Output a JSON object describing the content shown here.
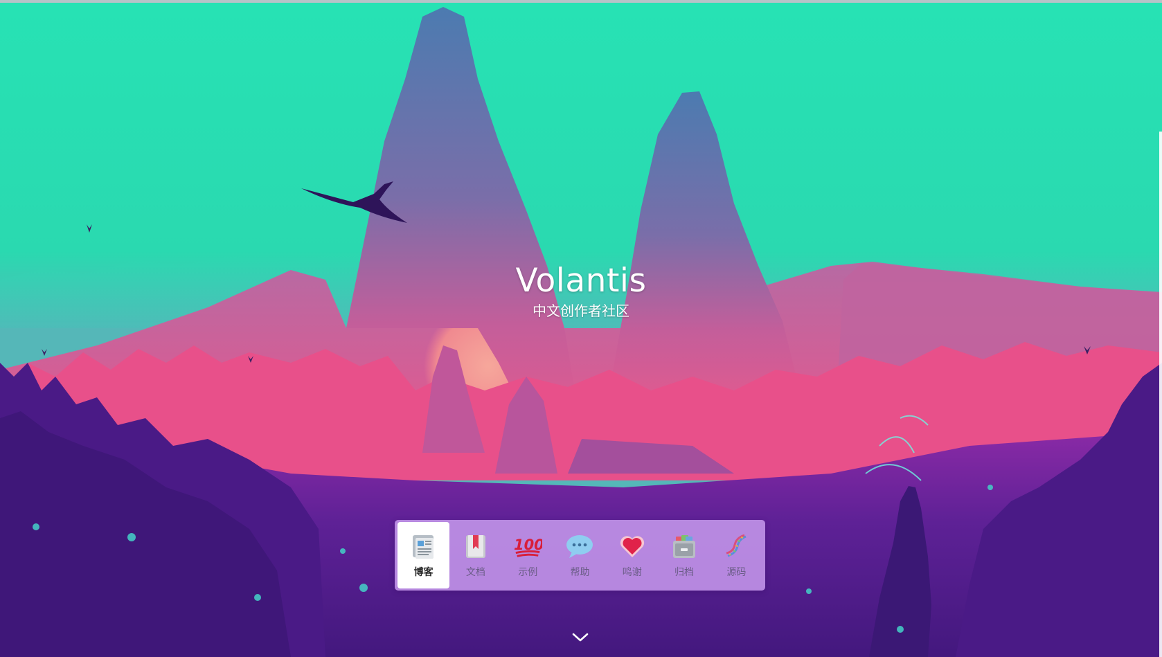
{
  "hero": {
    "title": "Volantis",
    "subtitle": "中文创作者社区"
  },
  "nav": {
    "items": [
      {
        "label": "博客",
        "icon": "newspaper-icon",
        "active": true
      },
      {
        "label": "文档",
        "icon": "bookmark-book-icon",
        "active": false
      },
      {
        "label": "示例",
        "icon": "hundred-points-icon",
        "active": false
      },
      {
        "label": "帮助",
        "icon": "speech-bubble-icon",
        "active": false
      },
      {
        "label": "鸣谢",
        "icon": "heart-icon",
        "active": false
      },
      {
        "label": "归档",
        "icon": "file-cabinet-icon",
        "active": false
      },
      {
        "label": "源码",
        "icon": "dna-icon",
        "active": false
      }
    ]
  },
  "scroll": {
    "icon": "chevron-down-icon"
  },
  "colors": {
    "sky": "#27e2b4",
    "mountain": "#5a7bb0",
    "sun": "#f28a8f",
    "forest_pink": "#e8508a",
    "ground_purple": "#4b1c86",
    "navbar": "#c496eb"
  }
}
